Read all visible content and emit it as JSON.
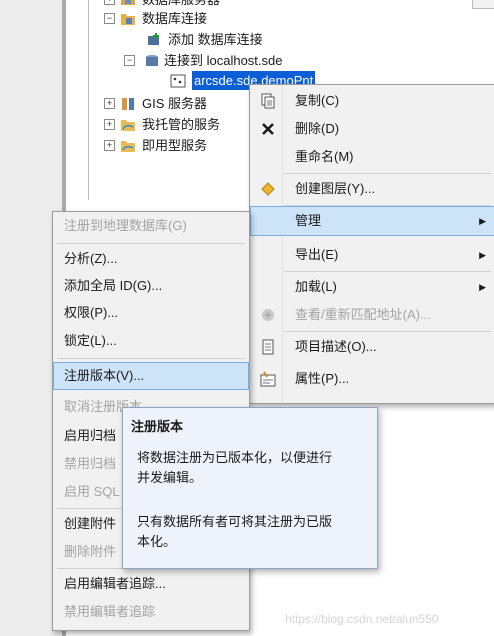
{
  "tree": {
    "top_partial": "数据库服务器",
    "db_connections": "数据库连接",
    "add_connection": "添加 数据库连接",
    "connect_to": "连接到 localhost.sde",
    "selected_item": "arcsde.sde.demoPnt",
    "gis_servers": "GIS 服务器",
    "my_hosted": "我托管的服务",
    "ready_services": "即用型服务"
  },
  "context_menu": {
    "items": [
      {
        "label": "复制(C)",
        "icon": "copy-icon"
      },
      {
        "label": "删除(D)",
        "icon": "delete-icon"
      },
      {
        "label": "重命名(M)"
      },
      {
        "label": "创建图层(Y)...",
        "icon": "layer-icon"
      },
      {
        "label": "管理",
        "submenu": true
      },
      {
        "label": "导出(E)",
        "submenu": true
      },
      {
        "label": "加载(L)",
        "submenu": true
      },
      {
        "label": "查看/重新匹配地址(A)...",
        "disabled": true,
        "icon": "geocode-icon"
      },
      {
        "label": "项目描述(O)...",
        "icon": "description-icon"
      },
      {
        "label": "属性(P)...",
        "icon": "properties-icon"
      }
    ]
  },
  "manage_submenu": {
    "items": [
      {
        "label": "注册到地理数据库(G)",
        "disabled": true
      },
      {
        "label": "分析(Z)..."
      },
      {
        "label": "添加全局 ID(G)..."
      },
      {
        "label": "权限(P)..."
      },
      {
        "label": "锁定(L)..."
      },
      {
        "label": "注册版本(V)..."
      },
      {
        "label": "取消注册版本",
        "disabled": true
      },
      {
        "label": "启用归档"
      },
      {
        "label": "禁用归档",
        "disabled": true
      },
      {
        "label": "启用 SQL",
        "disabled": true
      },
      {
        "label": "创建附件"
      },
      {
        "label": "删除附件",
        "disabled": true
      },
      {
        "label": "启用编辑者追踪..."
      },
      {
        "label": "禁用编辑者追踪",
        "disabled": true
      }
    ]
  },
  "tooltip": {
    "title": "注册版本",
    "line1": "将数据注册为已版本化，以便进行",
    "line2": "并发编辑。",
    "line3": "只有数据所有者可将其注册为已版",
    "line4": "本化。"
  },
  "watermark": "https://blog.csdn.net/alun550",
  "colors": {
    "selection": "#0a5fd6",
    "highlight": "#cde3f7",
    "tooltip_bg": "#eef3fb"
  }
}
